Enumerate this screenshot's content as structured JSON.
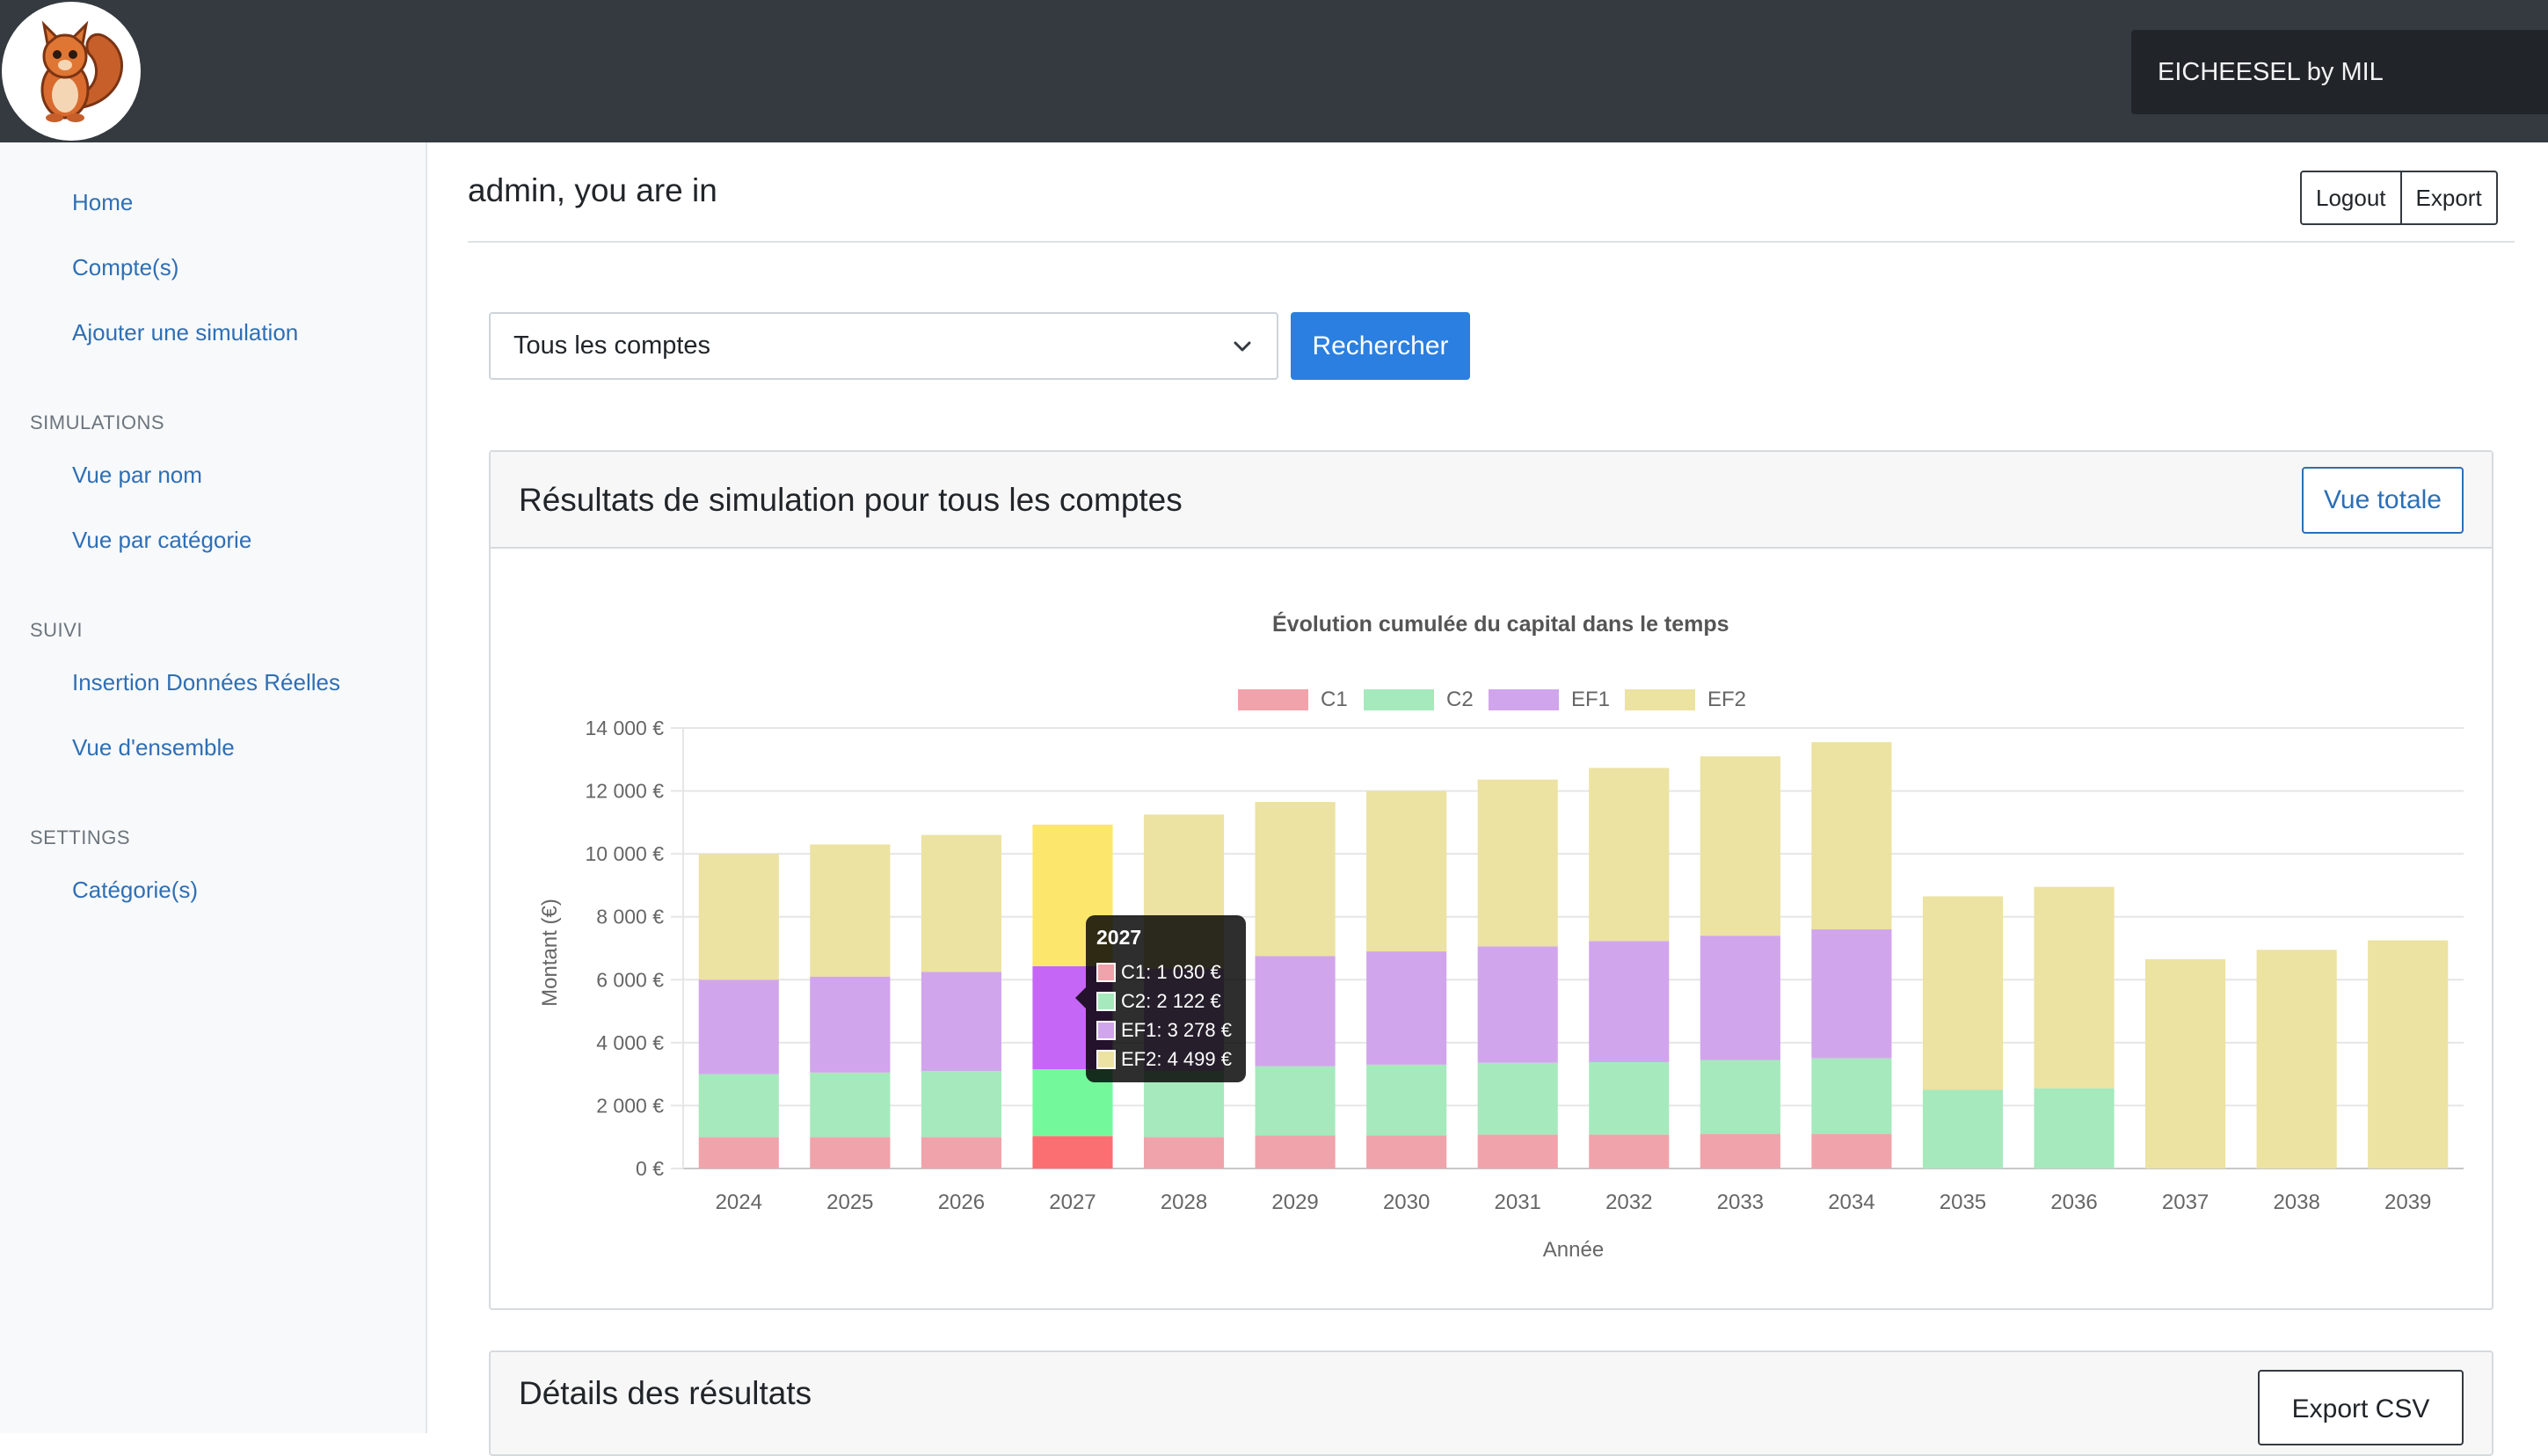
{
  "header": {
    "brand": "EICHEESEL by MIL"
  },
  "sidebar": {
    "links_top": [
      "Home",
      "Compte(s)",
      "Ajouter une simulation"
    ],
    "sections": [
      {
        "heading": "SIMULATIONS",
        "items": [
          "Vue par nom",
          "Vue par catégorie"
        ]
      },
      {
        "heading": "SUIVI",
        "items": [
          "Insertion Données Réelles",
          "Vue d'ensemble"
        ]
      },
      {
        "heading": "SETTINGS",
        "items": [
          "Catégorie(s)"
        ]
      }
    ]
  },
  "main": {
    "greeting": "admin, you are in",
    "logout_label": "Logout",
    "export_label": "Export",
    "account_select": {
      "value": "Tous les comptes"
    },
    "search_label": "Rechercher",
    "results_card": {
      "title": "Résultats de simulation pour tous les comptes",
      "total_view_label": "Vue totale"
    },
    "details_card": {
      "title": "Détails des résultats",
      "export_csv_label": "Export CSV"
    }
  },
  "chart_data": {
    "type": "bar",
    "stacked": true,
    "title": "Évolution cumulée du capital dans le temps",
    "xlabel": "Année",
    "ylabel": "Montant (€)",
    "ylim": [
      0,
      14000
    ],
    "yticks": [
      "0 €",
      "2 000 €",
      "4 000 €",
      "6 000 €",
      "8 000 €",
      "10 000 €",
      "12 000 €",
      "14 000 €"
    ],
    "grid": true,
    "legend_position": "top",
    "categories": [
      "2024",
      "2025",
      "2026",
      "2027",
      "2028",
      "2029",
      "2030",
      "2031",
      "2032",
      "2033",
      "2034",
      "2035",
      "2036",
      "2037",
      "2038",
      "2039"
    ],
    "series": [
      {
        "name": "C1",
        "color": "#f0a3aa",
        "values": [
          1000,
          1000,
          1000,
          1030,
          1000,
          1050,
          1050,
          1080,
          1080,
          1100,
          1100,
          0,
          0,
          0,
          0,
          0
        ]
      },
      {
        "name": "C2",
        "color": "#a6e9bd",
        "values": [
          2000,
          2050,
          2100,
          2122,
          2100,
          2200,
          2250,
          2280,
          2300,
          2350,
          2400,
          2500,
          2550,
          0,
          0,
          0
        ]
      },
      {
        "name": "EF1",
        "color": "#d1a5ec",
        "values": [
          3000,
          3050,
          3150,
          3278,
          3250,
          3500,
          3600,
          3700,
          3850,
          3950,
          4100,
          0,
          0,
          0,
          0,
          0
        ]
      },
      {
        "name": "EF2",
        "color": "#ece2a2",
        "values": [
          4000,
          4200,
          4350,
          4499,
          4900,
          4900,
          5100,
          5300,
          5500,
          5700,
          5950,
          6150,
          6400,
          6650,
          6950,
          7250
        ]
      }
    ],
    "highlight": {
      "category": "2027",
      "colors": [
        "#fb6f72",
        "#73f99b",
        "#c566f7",
        "#fce66c"
      ],
      "tooltip_title": "2027",
      "tooltip_lines": [
        "C1: 1 030 €",
        "C2: 2 122 €",
        "EF1: 3 278 €",
        "EF2: 4 499 €"
      ]
    }
  }
}
